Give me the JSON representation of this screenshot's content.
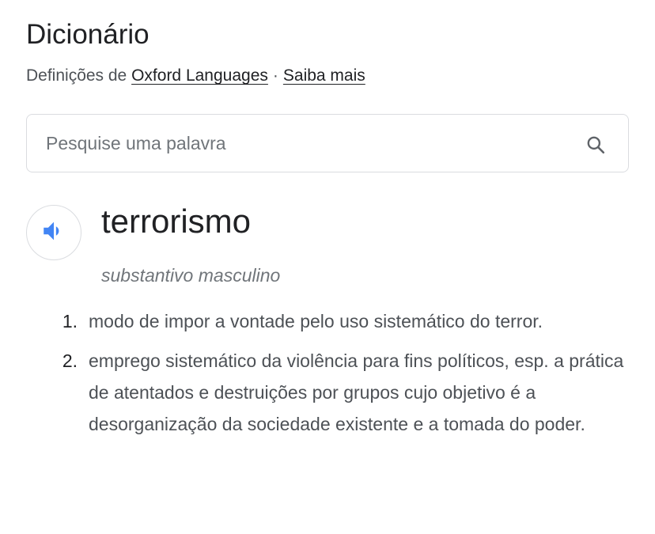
{
  "dictionary": {
    "title": "Dicionário",
    "source_prefix": "Definições de",
    "source_link": "Oxford Languages",
    "separator": "·",
    "more_link": "Saiba mais"
  },
  "search": {
    "placeholder": "Pesquise uma palavra",
    "icon": "search-icon"
  },
  "entry": {
    "audio_icon": "speaker-icon",
    "word": "terrorismo",
    "part_of_speech": "substantivo masculino",
    "definitions": [
      {
        "number": "1.",
        "text": "modo de impor a vontade pelo uso sistemático do terror."
      },
      {
        "number": "2.",
        "text": "emprego sistemático da violência para fins políticos, esp. a prática de atentados e destruições por grupos cujo objetivo é a desorganização da sociedade existente e a tomada do poder."
      }
    ]
  },
  "colors": {
    "accent_blue": "#4285f4",
    "text_primary": "#202124",
    "text_secondary": "#4d5156",
    "text_muted": "#70757a",
    "border": "#dadce0"
  }
}
